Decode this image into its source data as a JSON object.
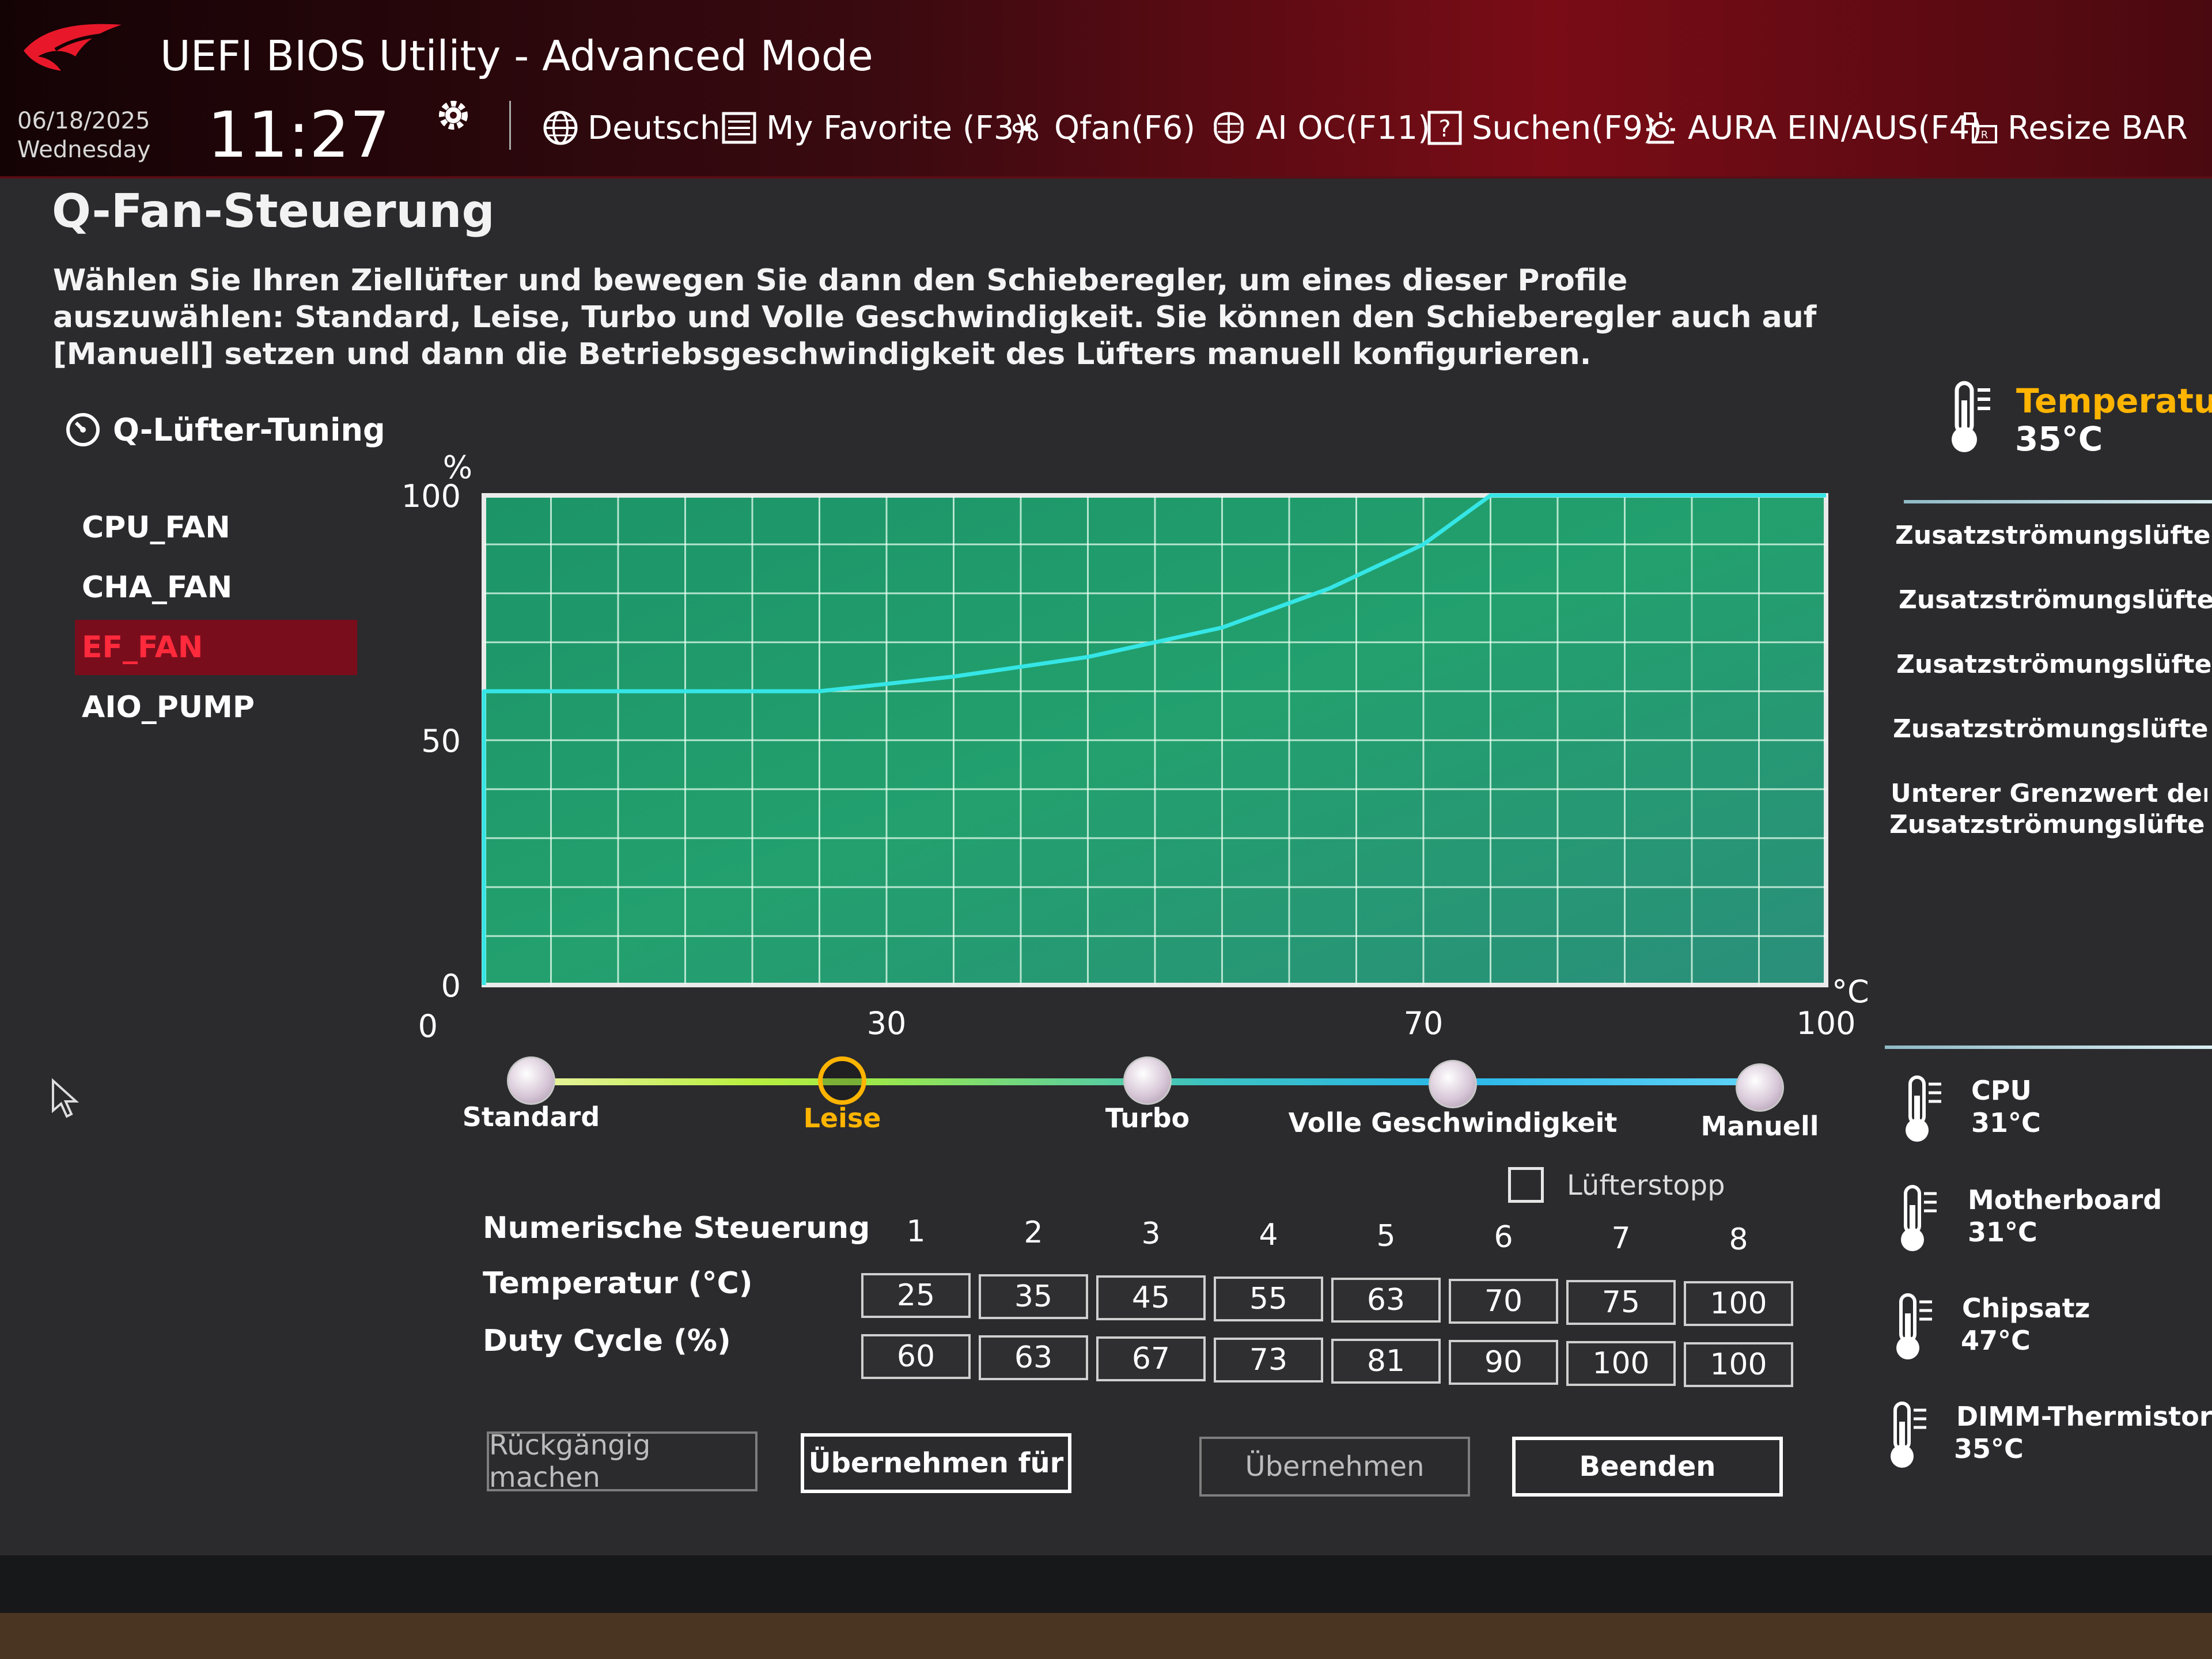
{
  "header": {
    "app_title": "UEFI BIOS Utility - Advanced Mode",
    "date": "06/18/2025",
    "weekday": "Wednesday",
    "time": "11:27",
    "menu": [
      {
        "label": "Deutsch",
        "icon": "globe-icon"
      },
      {
        "label": "My Favorite (F3)",
        "icon": "favorite-list-icon"
      },
      {
        "label": "Qfan(F6)",
        "icon": "fan-icon"
      },
      {
        "label": "AI OC(F11)",
        "icon": "ai-chip-icon"
      },
      {
        "label": "Suchen(F9)",
        "icon": "help-search-icon"
      },
      {
        "label": "AURA EIN/AUS(F4)",
        "icon": "aura-light-icon"
      },
      {
        "label": "Resize BAR",
        "icon": "resize-bar-icon"
      }
    ]
  },
  "page": {
    "title": "Q-Fan-Steuerung",
    "description": "Wählen Sie Ihren Ziellüfter und bewegen Sie dann den Schieberegler, um eines dieser Profile auszuwählen: Standard, Leise, Turbo und Volle Geschwindigkeit. Sie können den Schieberegler auch auf [Manuell] setzen und dann die Betriebsgeschwindigkeit des Lüfters manuell konfigurieren."
  },
  "fan_panel": {
    "title": "Q-Lüfter-Tuning",
    "fans": [
      "CPU_FAN",
      "CHA_FAN",
      "EF_FAN",
      "AIO_PUMP"
    ],
    "selected": "EF_FAN"
  },
  "chart_data": {
    "type": "line",
    "title": "",
    "xlabel": "°C",
    "ylabel": "%",
    "x_ticks": [
      "30",
      "70",
      "100"
    ],
    "y_ticks": [
      "100",
      "50",
      "0"
    ],
    "xlim": [
      0,
      100
    ],
    "ylim": [
      0,
      100
    ],
    "grid": true,
    "series": [
      {
        "x": [
          0,
          0,
          25,
          35,
          45,
          55,
          63,
          70,
          75,
          100
        ],
        "y": [
          0,
          60,
          60,
          63,
          67,
          73,
          81,
          90,
          100,
          100
        ]
      }
    ],
    "colors": {
      "line": "#35e6e6",
      "grid": "#e8fff0",
      "background": "#1f9a6a"
    }
  },
  "profiles": {
    "options": [
      "Standard",
      "Leise",
      "Turbo",
      "Volle Geschwindigkeit",
      "Manuell"
    ],
    "selected": "Leise"
  },
  "fan_stop": {
    "label": "Lüfterstopp",
    "checked": false
  },
  "numeric": {
    "title": "Numerische Steuerung",
    "points": [
      "1",
      "2",
      "3",
      "4",
      "5",
      "6",
      "7",
      "8"
    ],
    "temperature_label": "Temperatur (°C)",
    "temperature": [
      "25",
      "35",
      "45",
      "55",
      "63",
      "70",
      "75",
      "100"
    ],
    "duty_label": "Duty Cycle (%)",
    "duty": [
      "60",
      "63",
      "67",
      "73",
      "81",
      "90",
      "100",
      "100"
    ]
  },
  "buttons": {
    "undo": "Rückgängig machen",
    "apply_for": "Übernehmen für",
    "apply": "Übernehmen",
    "exit": "Beenden"
  },
  "right_panel": {
    "temperature_label": "Temperatur",
    "temperature_value": "35°C",
    "options": [
      "Zusatzströmungslüfter Q-Lü",
      "Zusatzströmungslüfter Q-Lü",
      "Zusatzströmungslüfter Step",
      "Zusatzströmungslüfter Step",
      "Unterer Grenzwert der",
      "Zusatzströmungslüfter-Gesch"
    ],
    "sensors": [
      {
        "name": "CPU",
        "value": "31°C"
      },
      {
        "name": "Motherboard",
        "value": "31°C"
      },
      {
        "name": "Chipsatz",
        "value": "47°C"
      },
      {
        "name": "DIMM-Thermistor",
        "value": "35°C"
      }
    ]
  }
}
